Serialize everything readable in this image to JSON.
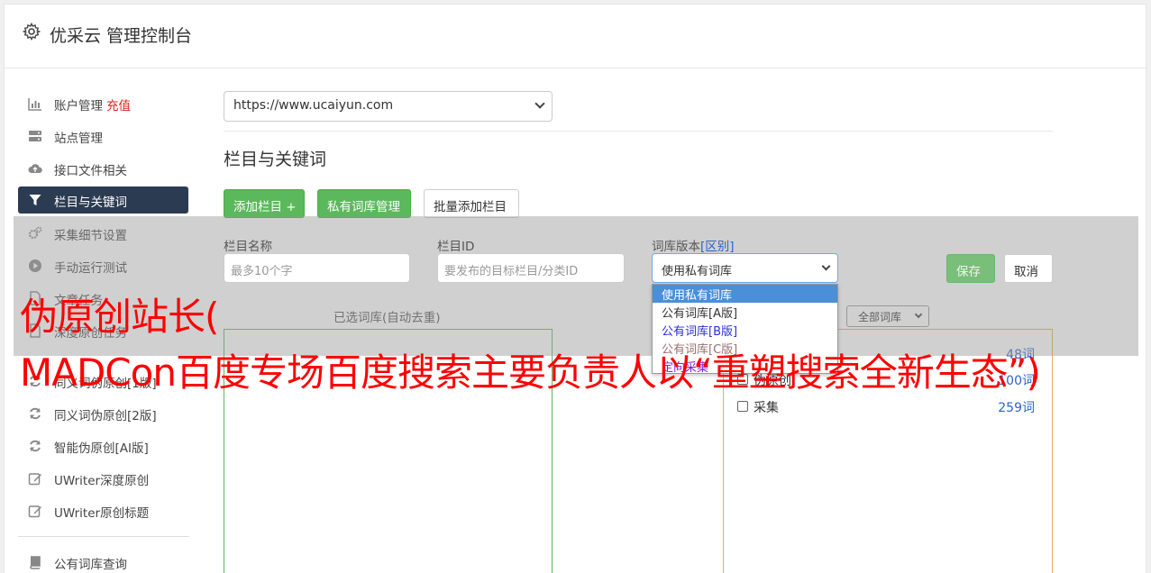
{
  "header": {
    "title": "优采云 管理控制台",
    "icon": "gear-icon"
  },
  "sidebar": {
    "items": [
      {
        "label": "账户管理",
        "extra": "充值",
        "icon": "bar-chart-icon"
      },
      {
        "label": "站点管理",
        "icon": "server-icon"
      },
      {
        "label": "接口文件相关",
        "icon": "cloud-upload-icon"
      },
      {
        "label": "栏目与关键词",
        "icon": "filter-icon",
        "active": true
      },
      {
        "label": "采集细节设置",
        "icon": "gears-icon"
      },
      {
        "label": "手动运行测试",
        "icon": "play-circle-icon"
      },
      {
        "label": "文章任务",
        "icon": "document-icon"
      },
      {
        "label": "深度原创任务",
        "icon": "document-icon"
      },
      {
        "label": "同义词伪原创[1版]",
        "icon": "refresh-icon"
      },
      {
        "label": "同义词伪原创[2版]",
        "icon": "refresh-icon"
      },
      {
        "label": "智能伪原创[AI版]",
        "icon": "refresh-icon"
      },
      {
        "label": "UWriter深度原创",
        "icon": "edit-icon"
      },
      {
        "label": "UWriter原创标题",
        "icon": "edit-icon"
      },
      {
        "label": "公有词库查询",
        "icon": "book-icon"
      }
    ]
  },
  "main": {
    "site_select": "https://www.ucaiyun.com",
    "section_title": "栏目与关键词",
    "buttons": {
      "add_column": "添加栏目 +",
      "private_lib": "私有词库管理",
      "batch_add": "批量添加栏目"
    },
    "form": {
      "name_label": "栏目名称",
      "name_placeholder": "最多10个字",
      "id_label": "栏目ID",
      "id_placeholder": "要发布的目标栏目/分类ID",
      "lib_label": "词库版本",
      "lib_label_link": "[区别]",
      "lib_selected": "使用私有词库",
      "save": "保存",
      "cancel": "取消"
    },
    "dropdown_options": [
      "使用私有词库",
      "公有词库[A版]",
      "公有词库[B版]",
      "公有词库[C版]",
      "定向采集"
    ],
    "selected_panel_label": "已选词库(自动去重)",
    "filter_select": "全部词库",
    "libraries": [
      {
        "name": "",
        "count": "48词"
      },
      {
        "name": "伪原创",
        "count": "100词"
      },
      {
        "name": "采集",
        "count": "259词"
      }
    ]
  },
  "watermark": {
    "line1": "伪原创站长(",
    "line2": "MADCon百度专场百度搜索主要负责人以“重塑搜索全新生态”)"
  }
}
